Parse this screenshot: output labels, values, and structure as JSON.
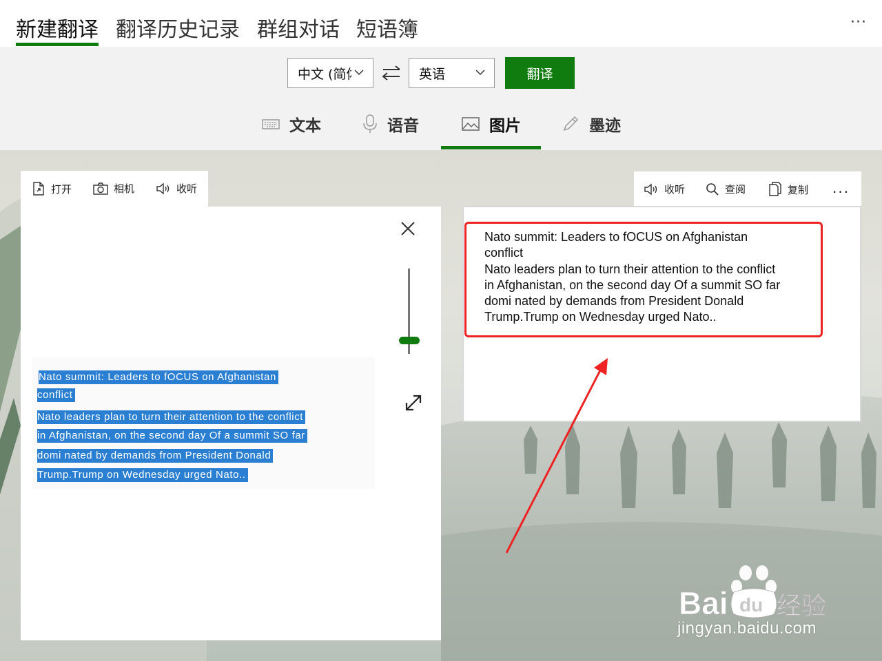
{
  "nav": {
    "tabs": [
      {
        "label": "新建翻译",
        "active": true
      },
      {
        "label": "翻译历史记录"
      },
      {
        "label": "群组对话"
      },
      {
        "label": "短语簿"
      }
    ],
    "more": "···"
  },
  "controls": {
    "source_language": "中文 (简体",
    "target_language": "英语",
    "translate_label": "翻译",
    "accent": "#107c10"
  },
  "modes": [
    {
      "label": "文本",
      "icon": "keyboard-icon"
    },
    {
      "label": "语音",
      "icon": "microphone-icon"
    },
    {
      "label": "图片",
      "icon": "image-icon",
      "active": true
    },
    {
      "label": "墨迹",
      "icon": "pen-icon"
    }
  ],
  "left_toolbar": {
    "open": "打开",
    "camera": "相机",
    "listen": "收听"
  },
  "source_image_text": [
    "Nato summit: Leaders to fOCUS on Afghanistan",
    "conflict",
    " Nato leaders plan to turn their attention to the conflict",
    "in Afghanistan, on the second day Of a summit SO far",
    "domi nated by demands from President Donald",
    "Trump.Trump on Wednesday urged Nato.."
  ],
  "right_toolbar": {
    "listen": "收听",
    "lookup": "查阅",
    "copy": "复制",
    "more": "..."
  },
  "output_text": [
    "Nato summit: Leaders to fOCUS on Afghanistan",
    "conflict",
    "Nato leaders plan to turn their attention to the conflict",
    "in Afghanistan, on the second day Of a summit SO far",
    "domi nated by demands from President Donald",
    "Trump.Trump on Wednesday urged Nato.."
  ],
  "annotation_color": "#ee2222",
  "watermark": {
    "brand": "Baidu经验",
    "url": "jingyan.baidu.com"
  }
}
